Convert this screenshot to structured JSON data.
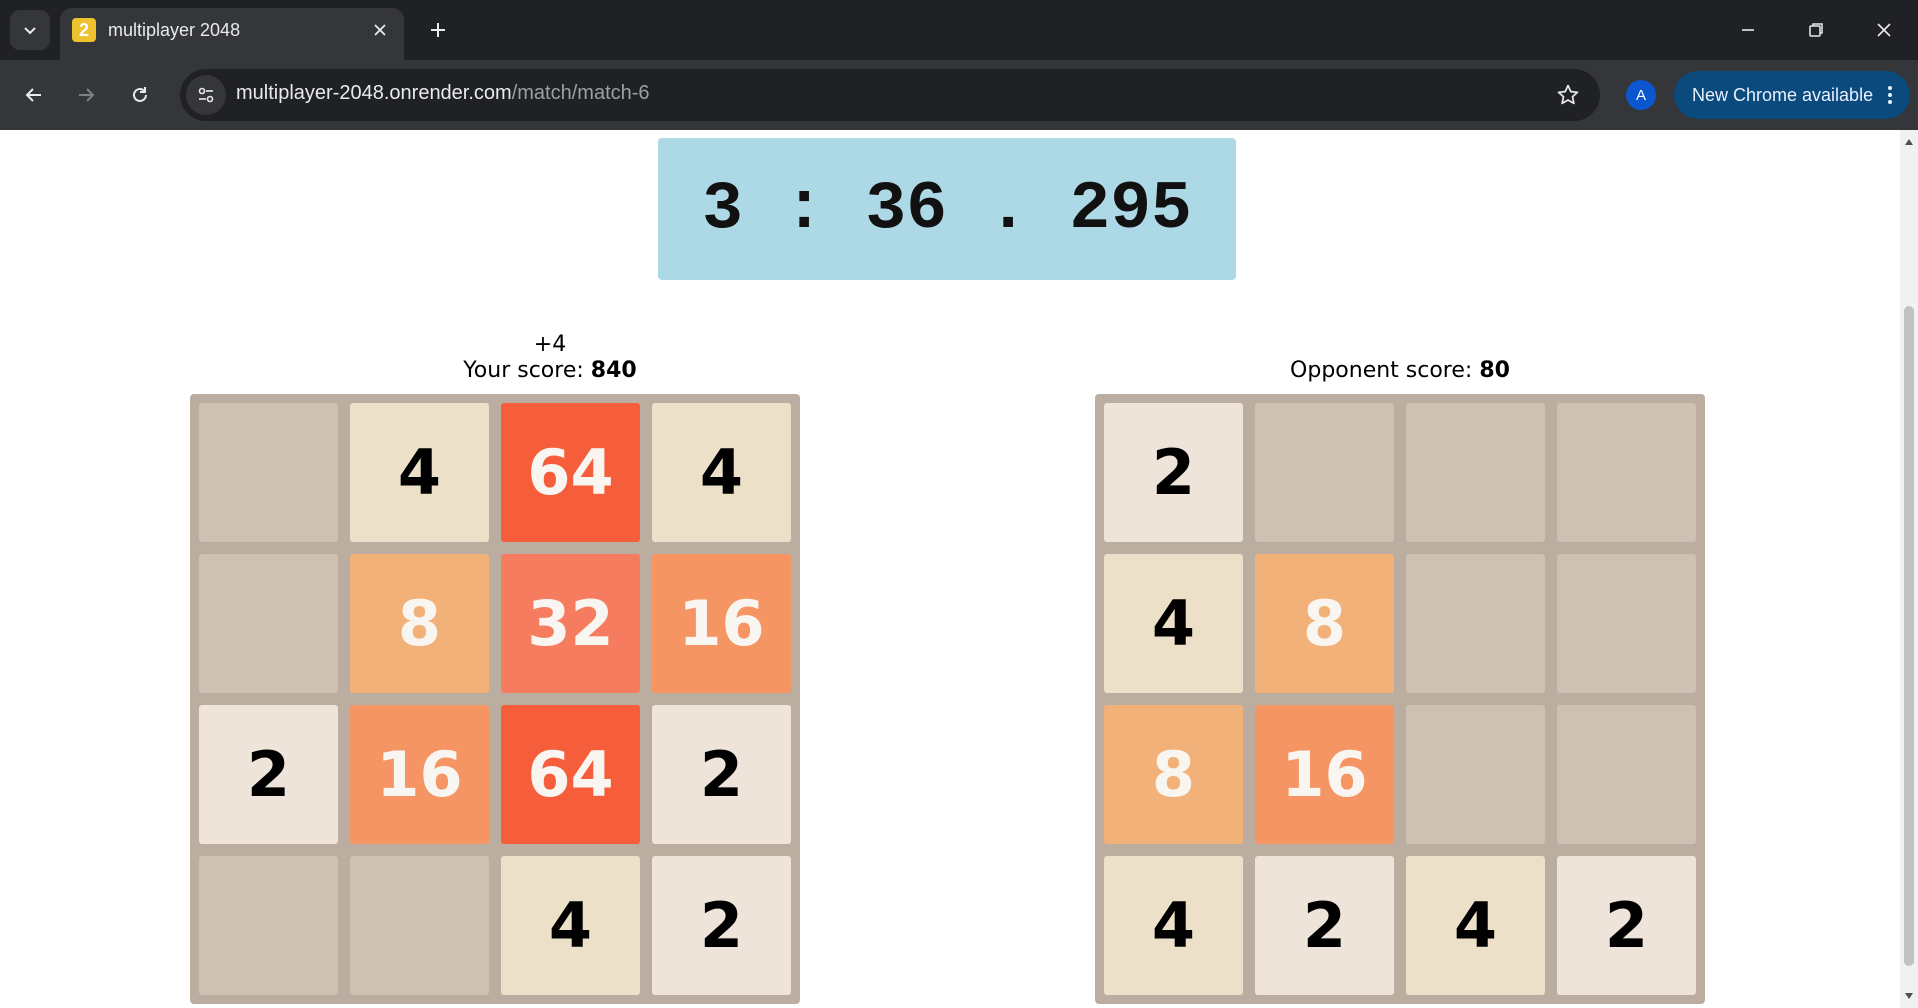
{
  "browser": {
    "tab_title": "multiplayer 2048",
    "favicon_text": "2",
    "url_host": "multiplayer-2048.onrender.com",
    "url_path": "/match/match-6",
    "profile_initial": "A",
    "update_chip_label": "New Chrome available"
  },
  "timer": {
    "display": "3 : 36 . 295"
  },
  "player": {
    "score_label": "Your score: ",
    "score_value": "840",
    "score_delta": "+4"
  },
  "opponent": {
    "score_label": "Opponent score: ",
    "score_value": "80"
  },
  "tile_colors": {
    "0": {
      "bg": "#cdc1b4",
      "fg": "#000000"
    },
    "2": {
      "bg": "#eee4da",
      "fg": "#000000"
    },
    "4": {
      "bg": "#ede0c8",
      "fg": "#000000"
    },
    "8": {
      "bg": "#f2b179",
      "fg": "#f9f6f2"
    },
    "16": {
      "bg": "#f59563",
      "fg": "#f9f6f2"
    },
    "32": {
      "bg": "#f67c5f",
      "fg": "#f9f6f2"
    },
    "64": {
      "bg": "#f65e3b",
      "fg": "#f9f6f2"
    }
  },
  "boards": {
    "player": [
      [
        0,
        4,
        64,
        4
      ],
      [
        0,
        8,
        32,
        16
      ],
      [
        2,
        16,
        64,
        2
      ],
      [
        0,
        0,
        4,
        2
      ]
    ],
    "opponent": [
      [
        2,
        0,
        0,
        0
      ],
      [
        4,
        8,
        0,
        0
      ],
      [
        8,
        16,
        0,
        0
      ],
      [
        4,
        2,
        4,
        2
      ]
    ]
  }
}
